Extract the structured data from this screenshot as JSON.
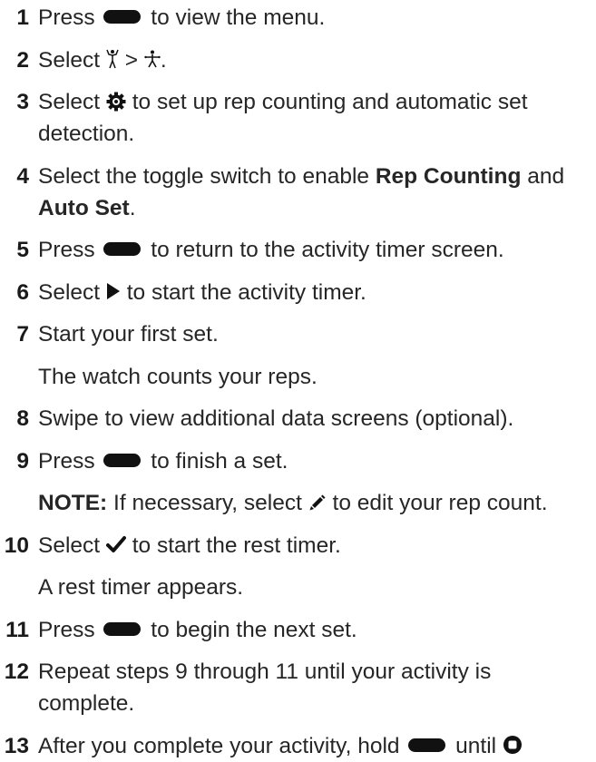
{
  "steps": [
    {
      "num": "1",
      "t1": "Press",
      "t2": "to view the menu."
    },
    {
      "num": "2",
      "t1": "Select",
      "t2": ">",
      "t3": "."
    },
    {
      "num": "3",
      "t1": "Select",
      "t2": "to set up rep counting and automatic set detection."
    },
    {
      "num": "4",
      "t1": "Select the toggle switch to enable",
      "b1": "Rep Counting",
      "t2": "and",
      "b2": "Auto Set",
      "t3": "."
    },
    {
      "num": "5",
      "t1": "Press",
      "t2": "to return to the activity timer screen."
    },
    {
      "num": "6",
      "t1": "Select",
      "t2": "to start the activity timer."
    },
    {
      "num": "7",
      "t1": "Start your first set.",
      "sub": "The watch counts your reps."
    },
    {
      "num": "8",
      "t1": "Swipe to view additional data screens (optional)."
    },
    {
      "num": "9",
      "t1": "Press",
      "t2": "to finish a set.",
      "note_label": "NOTE:",
      "note_t1": "If necessary, select",
      "note_t2": "to edit your rep count."
    },
    {
      "num": "10",
      "t1": "Select",
      "t2": "to start the rest timer.",
      "sub": "A rest timer appears."
    },
    {
      "num": "11",
      "t1": "Press",
      "t2": "to begin the next set."
    },
    {
      "num": "12",
      "t1": "Repeat steps 9 through 11 until your activity is complete."
    },
    {
      "num": "13",
      "t1": "After you complete your activity, hold",
      "t2": "until"
    }
  ],
  "icons": {
    "button": "action-button-icon",
    "strength": "strength-activity-icon",
    "more": "more-activities-icon",
    "settings": "gear-icon",
    "play": "play-icon",
    "edit": "pencil-icon",
    "check": "checkmark-icon",
    "stop": "stop-icon"
  },
  "colors": {
    "text": "#262626",
    "icon": "#111111"
  }
}
